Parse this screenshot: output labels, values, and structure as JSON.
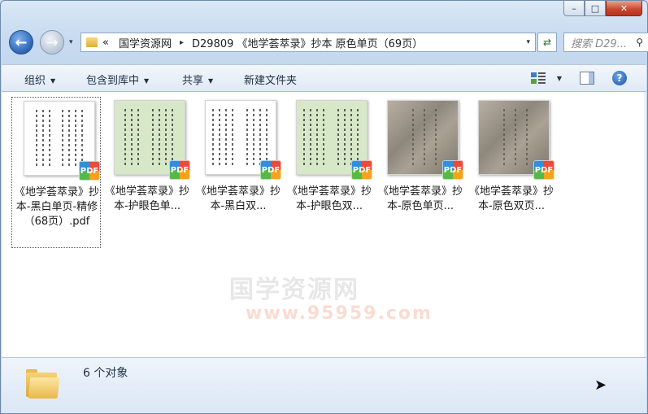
{
  "window": {
    "controls": {
      "minimize": "–",
      "maximize": "□",
      "close": "✕"
    }
  },
  "nav": {
    "history_glyph": "▾",
    "breadcrumb": [
      "«",
      "国学资源网",
      "▸",
      "D29809 《地学荟萃录》抄本 原色单页（69页）"
    ],
    "address_dropdown": "▾",
    "refresh_glyph": "⇄",
    "search_placeholder": "搜索 D29...",
    "search_icon": "⚲"
  },
  "toolbar": {
    "organize": "组织",
    "include_library": "包含到库中",
    "share": "共享",
    "new_folder": "新建文件夹",
    "help": "?"
  },
  "files": [
    {
      "label": "《地学荟萃录》抄本-黑白单页-精修（68页）.pdf",
      "badge": "PDF",
      "thumb": "white"
    },
    {
      "label": "《地学荟萃录》抄本-护眼色单...",
      "badge": "PDF",
      "thumb": "green"
    },
    {
      "label": "《地学荟萃录》抄本-黑白双...",
      "badge": "PDF",
      "thumb": "white"
    },
    {
      "label": "《地学荟萃录》抄本-护眼色双...",
      "badge": "PDF",
      "thumb": "green"
    },
    {
      "label": "《地学荟萃录》抄本-原色单页...",
      "badge": "PDF",
      "thumb": "old"
    },
    {
      "label": "《地学荟萃录》抄本-原色双页...",
      "badge": "PDF",
      "thumb": "old"
    }
  ],
  "watermark": {
    "line1": "国学资源网",
    "line2": "www.95959.com"
  },
  "status": {
    "count": "6 个对象"
  }
}
